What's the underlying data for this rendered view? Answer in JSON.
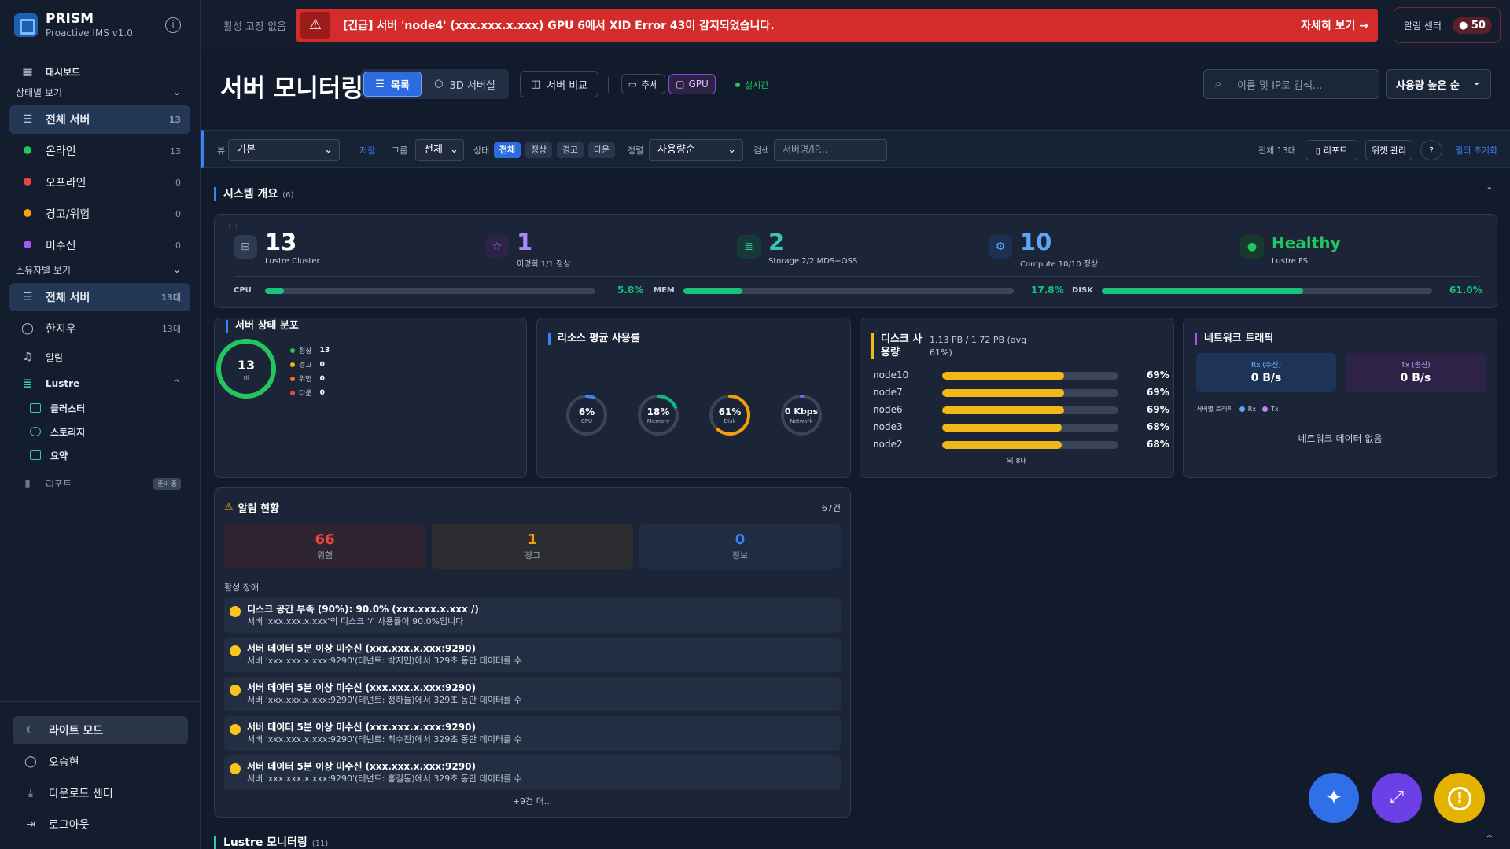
{
  "sidebar": {
    "brand": "PRISM",
    "brand_sub": "Proactive IMS v1.0",
    "dashboard": "대시보드",
    "status_section": "상태별 보기",
    "status_items": [
      {
        "label": "전체 서버",
        "count": "13"
      },
      {
        "label": "온라인",
        "count": "13"
      },
      {
        "label": "오프라인",
        "count": "0"
      },
      {
        "label": "경고/위험",
        "count": "0"
      },
      {
        "label": "미수신",
        "count": "0"
      }
    ],
    "owner_section": "소유자별 보기",
    "owner_items": [
      {
        "label": "전체 서버",
        "count": "13대"
      },
      {
        "label": "한지우",
        "count": "13대"
      }
    ],
    "alarm": "알림",
    "lustre": "Lustre",
    "lustre_items": [
      "클러스터",
      "스토리지",
      "요약"
    ],
    "report": "리포트",
    "report_badge": "준비 중",
    "bottom": [
      "라이트 모드",
      "오승현",
      "다운로드 센터",
      "로그아웃"
    ]
  },
  "topbar": {
    "status_text": "활성 고장 없음",
    "alert_text": "[긴급] 서버 'node4' (xxx.xxx.x.xxx) GPU 6에서 XID Error 43이 감지되었습니다.",
    "alert_link": "자세히 보기 →",
    "noti_label": "알림 센터",
    "noti_count": "50"
  },
  "header": {
    "title": "서버 모니터링",
    "view_list": "목록",
    "view_3d": "3D 서버실",
    "compare": "서버 비교",
    "trend": "추세",
    "gpu": "GPU",
    "realtime": "실시간",
    "search_placeholder": "이름 및 IP로 검색...",
    "sort": "사용량 높은 순"
  },
  "filterbar": {
    "view_lbl": "뷰",
    "view_val": "기본",
    "save": "저장",
    "group_lbl": "그룹",
    "group_val": "전체",
    "status_lbl": "상태",
    "status_chips": [
      "전체",
      "정상",
      "경고",
      "다운"
    ],
    "sort_lbl": "정렬",
    "sort_val": "사용량순",
    "search_lbl": "검색",
    "search_placeholder": "서버명/IP...",
    "total": "전체 13대",
    "report": "리포트",
    "widget": "위젯 관리",
    "help": "?",
    "reset": "필터 초기화"
  },
  "overview": {
    "title": "시스템 개요",
    "count": "(6)",
    "items": [
      {
        "value": "13",
        "sub": "Lustre Cluster"
      },
      {
        "value": "1",
        "sub": "이명희 1/1 정상"
      },
      {
        "value": "2",
        "sub": "Storage 2/2 MDS+OSS"
      },
      {
        "value": "10",
        "sub": "Compute 10/10 정상"
      },
      {
        "value": "Healthy",
        "sub": "Lustre FS"
      }
    ],
    "bars": [
      {
        "label": "CPU",
        "pct": "5.8%",
        "value": 5.8
      },
      {
        "label": "MEM",
        "pct": "17.8%",
        "value": 17.8
      },
      {
        "label": "DISK",
        "pct": "61.0%",
        "value": 61.0
      }
    ]
  },
  "server_status": {
    "title": "서버 상태 분포",
    "total": "13",
    "unit": "대",
    "legend": [
      {
        "label": "정상",
        "value": "13",
        "color": "#22c55e"
      },
      {
        "label": "경고",
        "value": "0",
        "color": "#f5b70a"
      },
      {
        "label": "위험",
        "value": "0",
        "color": "#f97316"
      },
      {
        "label": "다운",
        "value": "0",
        "color": "#ef4444"
      }
    ]
  },
  "resource": {
    "title": "리소스 평균 사용률",
    "gauges": [
      {
        "value": "6%",
        "label": "CPU",
        "pct": 6,
        "color": "#3b82f6"
      },
      {
        "value": "18%",
        "label": "Memory",
        "pct": 18,
        "color": "#10b981"
      },
      {
        "value": "61%",
        "label": "Disk",
        "pct": 61,
        "color": "#f59e0b"
      },
      {
        "value": "0 Kbps",
        "label": "Network",
        "pct": 1,
        "color": "#8b5cf6"
      }
    ]
  },
  "disk": {
    "title": "디스크 사용량",
    "summary": "1.13 PB / 1.72 PB (avg 61%)",
    "rows": [
      {
        "name": "node10",
        "pct": "69%",
        "value": 69
      },
      {
        "name": "node7",
        "pct": "69%",
        "value": 69
      },
      {
        "name": "node6",
        "pct": "69%",
        "value": 69
      },
      {
        "name": "node3",
        "pct": "68%",
        "value": 68
      },
      {
        "name": "node2",
        "pct": "68%",
        "value": 68
      }
    ],
    "more": "외 8대"
  },
  "network": {
    "title": "네트워크 트래픽",
    "rx_label": "Rx (수신)",
    "rx_value": "0 B/s",
    "tx_label": "Tx (송신)",
    "tx_value": "0 B/s",
    "per_server": "서버별 트래픽",
    "rx": "Rx",
    "tx": "Tx",
    "empty": "네트워크 데이터 없음"
  },
  "alarms": {
    "title": "알림 현황",
    "total": "67건",
    "stats": [
      {
        "num": "66",
        "label": "위험"
      },
      {
        "num": "1",
        "label": "경고"
      },
      {
        "num": "0",
        "label": "정보"
      }
    ],
    "active_label": "활성 장애",
    "items": [
      {
        "title": "디스크 공간 부족 (90%): 90.0% (xxx.xxx.x.xxx /)",
        "desc": "서버 'xxx.xxx.x.xxx'의 디스크 '/' 사용률이 90.0%입니다"
      },
      {
        "title": "서버 데이터 5분 이상 미수신 (xxx.xxx.x.xxx:9290)",
        "desc": "서버 'xxx.xxx.x.xxx:9290'(테넌트: 박지민)에서 329초 동안 데이터를 수"
      },
      {
        "title": "서버 데이터 5분 이상 미수신 (xxx.xxx.x.xxx:9290)",
        "desc": "서버 'xxx.xxx.x.xxx:9290'(테넌트: 정하늘)에서 329초 동안 데이터를 수"
      },
      {
        "title": "서버 데이터 5분 이상 미수신 (xxx.xxx.x.xxx:9290)",
        "desc": "서버 'xxx.xxx.x.xxx:9290'(테넌트: 최수진)에서 329초 동안 데이터를 수"
      },
      {
        "title": "서버 데이터 5분 이상 미수신 (xxx.xxx.x.xxx:9290)",
        "desc": "서버 'xxx.xxx.x.xxx:9290'(테넌트: 홍길동)에서 329초 동안 데이터를 수"
      }
    ],
    "more": "+9건 더..."
  },
  "lustre_section": {
    "title": "Lustre 모니터링",
    "count": "(11)"
  }
}
